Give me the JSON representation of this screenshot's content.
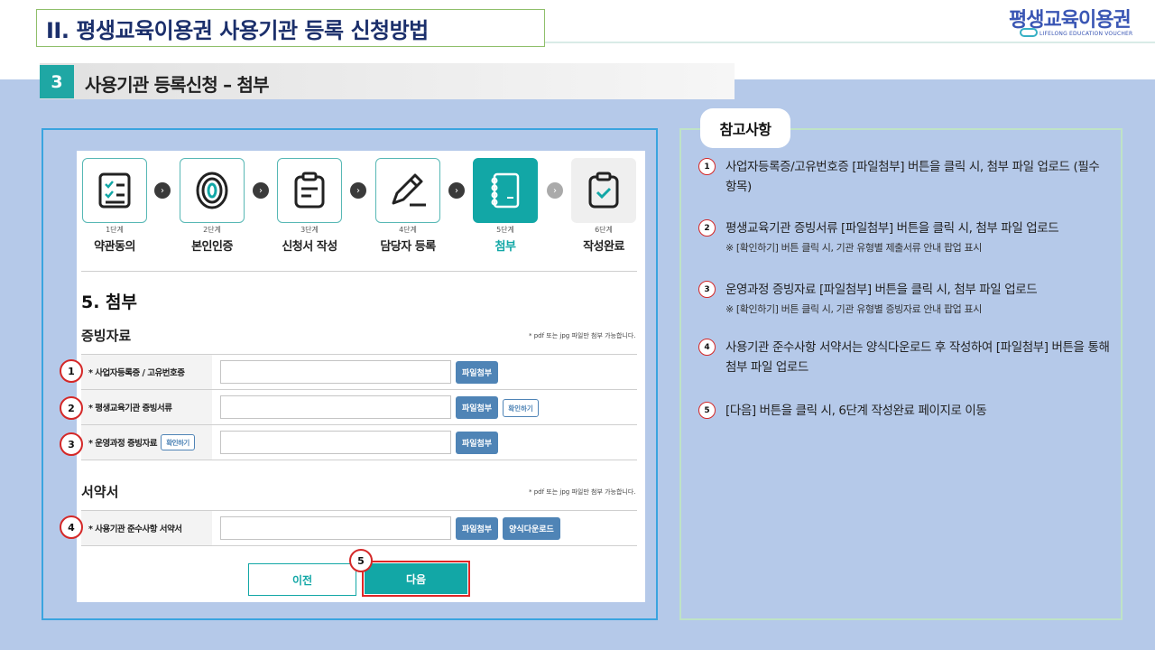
{
  "header": {
    "title": "II. 평생교육이용권 사용기관 등록 신청방법",
    "logo_text": "평생교육이용권",
    "logo_sub": "LIFELONG EDUCATION VOUCHER"
  },
  "section": {
    "number": "3",
    "title": "사용기관 등록신청 – 첨부"
  },
  "steps": [
    {
      "num": "1단계",
      "name": "약관동의",
      "icon": "checklist-icon"
    },
    {
      "num": "2단계",
      "name": "본인인증",
      "icon": "fingerprint-icon"
    },
    {
      "num": "3단계",
      "name": "신청서 작성",
      "icon": "form-icon"
    },
    {
      "num": "4단계",
      "name": "담당자 등록",
      "icon": "pencil-icon"
    },
    {
      "num": "5단계",
      "name": "첨부",
      "icon": "notebook-icon"
    },
    {
      "num": "6단계",
      "name": "작성완료",
      "icon": "clipboard-check-icon"
    }
  ],
  "form": {
    "title": "5. 첨부",
    "evidence_title": "증빙자료",
    "note": "* pdf 또는 jpg 파일만 첨부 가능합니다.",
    "rows": [
      {
        "label": "* 사업자등록증 / 고유번호증",
        "attach": "파일첨부"
      },
      {
        "label": "* 평생교육기관 증빙서류",
        "attach": "파일첨부",
        "check": "확인하기"
      },
      {
        "label": "* 운영과정 증빙자료",
        "attach": "파일첨부",
        "check": "확인하기"
      }
    ],
    "pledge_title": "서약서",
    "pledge_note": "* pdf 또는 jpg 파일만 첨부 가능합니다.",
    "pledge_row": {
      "label": "* 사용기관 준수사항 서약서",
      "attach": "파일첨부",
      "download": "양식다운로드"
    },
    "prev": "이전",
    "next": "다음"
  },
  "callouts": [
    "1",
    "2",
    "3",
    "4",
    "5"
  ],
  "reference": {
    "title": "참고사항",
    "items": [
      {
        "num": "1",
        "text": "사업자등록증/고유번호증 [파일첨부] 버튼을 클릭 시, 첨부 파일 업로드 (필수 항목)"
      },
      {
        "num": "2",
        "text": "평생교육기관 증빙서류 [파일첨부] 버튼을 클릭 시, 첨부 파일 업로드",
        "sub": "※ [확인하기] 버튼 클릭 시, 기관 유형별 제출서류 안내 팝업 표시"
      },
      {
        "num": "3",
        "text": "운영과정 증빙자료 [파일첨부] 버튼을 클릭 시, 첨부 파일 업로드",
        "sub": "※ [확인하기] 버튼 클릭 시, 기관 유형별 증빙자료 안내 팝업 표시"
      },
      {
        "num": "4",
        "text": "사용기관 준수사항 서약서는 양식다운로드 후 작성하여 [파일첨부] 버튼을 통해 첨부 파일 업로드"
      },
      {
        "num": "5",
        "text": "[다음] 버튼을 클릭 시, 6단계 작성완료 페이지로 이동"
      }
    ]
  },
  "colors": {
    "teal": "#12a7a6",
    "navy": "#1b2f6b",
    "blue_bg": "#b5c9e9",
    "attach_btn": "#4f84b6",
    "callout_red": "#d42828"
  }
}
